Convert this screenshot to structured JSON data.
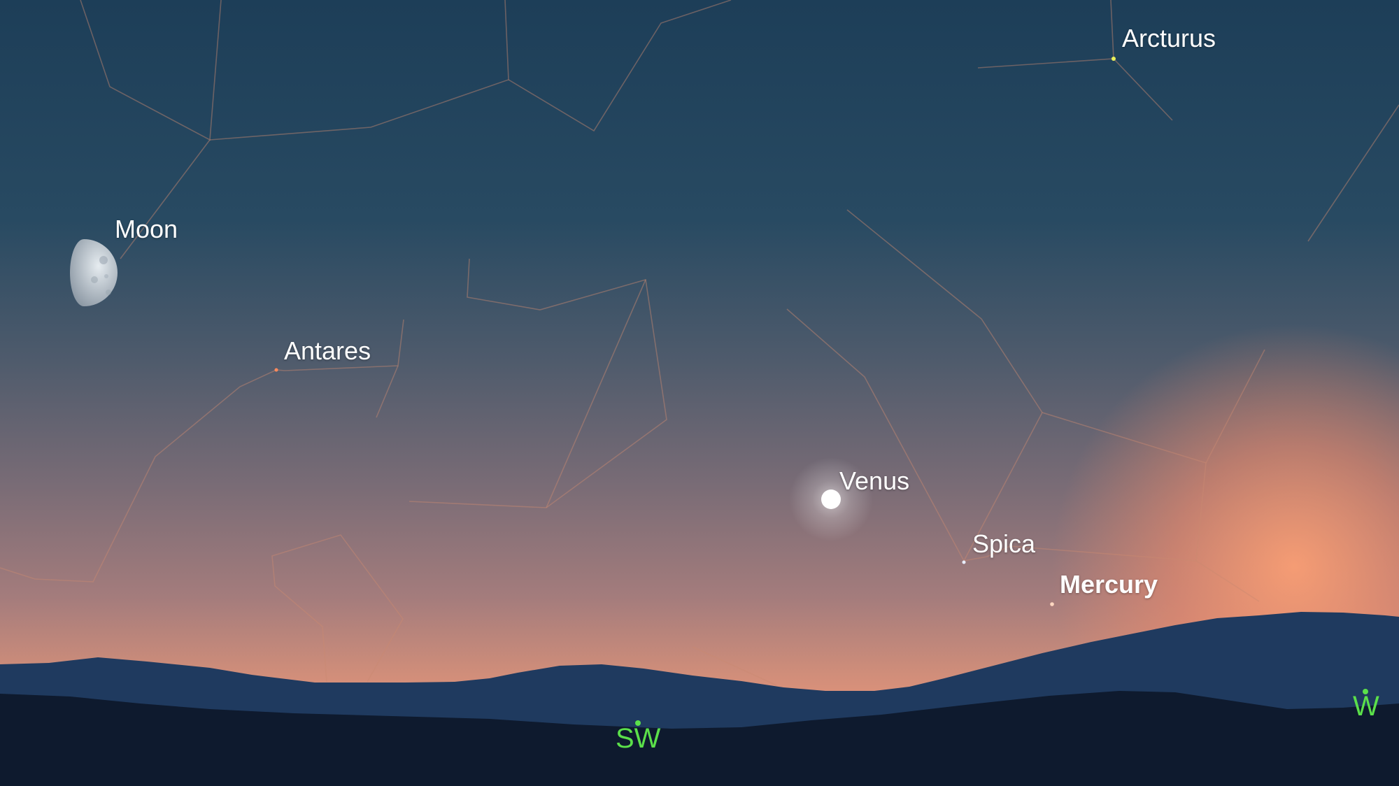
{
  "bodies": {
    "arcturus": "Arcturus",
    "moon": "Moon",
    "antares": "Antares",
    "venus": "Venus",
    "spica": "Spica",
    "mercury": "Mercury"
  },
  "directions": {
    "southwest": "SW",
    "west": "W"
  },
  "colors": {
    "constellation_line": "#c98a72",
    "direction_label": "#5be04a",
    "label": "#ffffff",
    "hills_far": "#1f3a5f",
    "hills_near": "#0e1a2e"
  }
}
